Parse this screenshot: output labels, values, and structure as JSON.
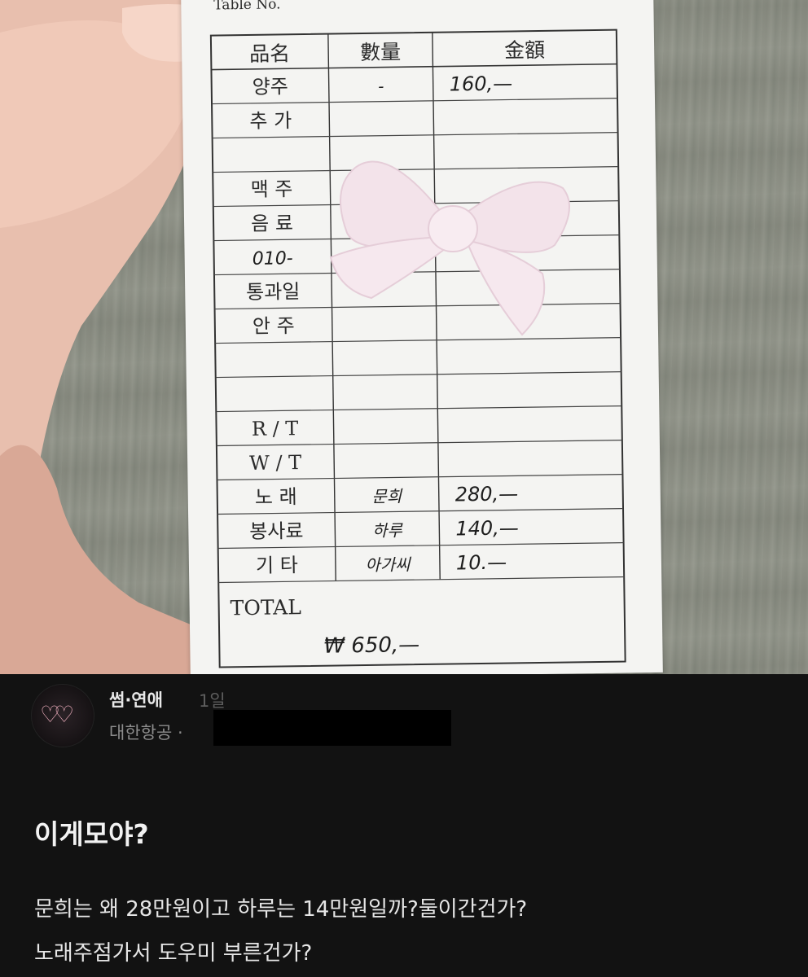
{
  "receipt": {
    "table_no_label": "Table No.",
    "headers": {
      "item": "品名",
      "qty": "數量",
      "amount": "金額"
    },
    "rows": [
      {
        "item": "양주",
        "qty": "-",
        "amount": "160,—"
      },
      {
        "item": "추 가",
        "qty": "",
        "amount": ""
      },
      {
        "item": "",
        "qty": "",
        "amount": ""
      },
      {
        "item": "맥 주",
        "qty": "",
        "amount": ""
      },
      {
        "item": "음 료",
        "qty": "",
        "amount": ""
      },
      {
        "item": "010-",
        "qty": "",
        "amount": ""
      },
      {
        "item": "통과일",
        "qty": "",
        "amount": ""
      },
      {
        "item": "안 주",
        "qty": "",
        "amount": ""
      },
      {
        "item": "",
        "qty": "",
        "amount": ""
      },
      {
        "item": "",
        "qty": "",
        "amount": ""
      },
      {
        "item": "R / T",
        "qty": "",
        "amount": ""
      },
      {
        "item": "W / T",
        "qty": "",
        "amount": ""
      },
      {
        "item": "노 래",
        "qty": "문희",
        "amount": "280,—"
      },
      {
        "item": "봉사료",
        "qty": "하루",
        "amount": "140,—"
      },
      {
        "item": "기 타",
        "qty": "아가씨",
        "amount": "10.—"
      }
    ],
    "total_label": "TOTAL",
    "total_value": "₩ 650,—"
  },
  "post": {
    "community": "썸·연애",
    "time": "1일",
    "company": "대한항공 ·",
    "title": "이게모야?",
    "body_line1": "문희는 왜 28만원이고 하루는 14만원일까?둘이간건가?",
    "body_line2": "노래주점가서 도우미 부른건가?"
  },
  "icons": {
    "avatar": "double-heart-icon",
    "bow": "ribbon-bow-sticker"
  },
  "colors": {
    "background": "#121212",
    "accent_heart": "#e7a9b8"
  }
}
